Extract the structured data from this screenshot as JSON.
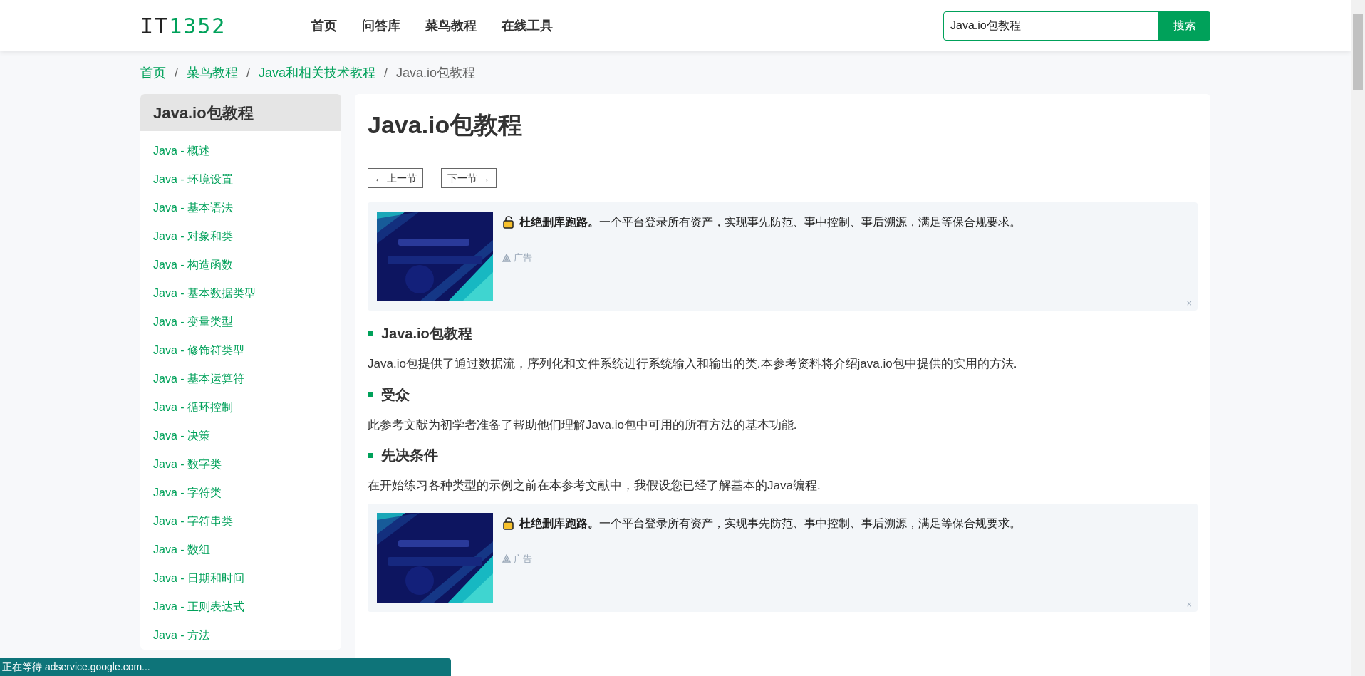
{
  "header": {
    "logo": {
      "prefix": "IT",
      "suffix": "1352"
    },
    "nav": [
      "首页",
      "问答库",
      "菜鸟教程",
      "在线工具"
    ],
    "search": {
      "value": "Java.io包教程",
      "button": "搜索"
    }
  },
  "breadcrumb": {
    "links": [
      "首页",
      "菜鸟教程",
      "Java和相关技术教程"
    ],
    "current": "Java.io包教程",
    "separator": "/"
  },
  "sidebar": {
    "title": "Java.io包教程",
    "items": [
      "Java - 概述",
      "Java - 环境设置",
      "Java - 基本语法",
      "Java - 对象和类",
      "Java - 构造函数",
      "Java - 基本数据类型",
      "Java - 变量类型",
      "Java - 修饰符类型",
      "Java - 基本运算符",
      "Java - 循环控制",
      "Java - 决策",
      "Java - 数字类",
      "Java - 字符类",
      "Java - 字符串类",
      "Java - 数组",
      "Java - 日期和时间",
      "Java - 正则表达式",
      "Java - 方法"
    ]
  },
  "article": {
    "title": "Java.io包教程",
    "prev": "← 上一节",
    "next": "下一节 →",
    "blocks": [
      {
        "kind": "ad",
        "text": "**杜绝删库跑路。**一个平台登录所有资产，实现事先防范、事中控制、事后溯源，满足等保合规要求。",
        "label": "广告",
        "close": "×"
      },
      {
        "kind": "section",
        "heading": "Java.io包教程",
        "text": "Java.io包提供了通过数据流，序列化和文件系统进行系统输入和输出的类.本参考资料将介绍java.io包中提供的实用的方法."
      },
      {
        "kind": "section",
        "heading": "受众",
        "text": "此参考文献为初学者准备了帮助他们理解Java.io包中可用的所有方法的基本功能."
      },
      {
        "kind": "section",
        "heading": "先决条件",
        "text": "在开始练习各种类型的示例之前在本参考文献中，我假设您已经了解基本的Java编程."
      },
      {
        "kind": "ad",
        "text": "**杜绝删库跑路。**一个平台登录所有资产，实现事先防范、事中控制、事后溯源，满足等保合规要求。",
        "label": "广告",
        "close": "×"
      }
    ]
  },
  "status_bar": {
    "text": "正在等待 adservice.google.com..."
  }
}
